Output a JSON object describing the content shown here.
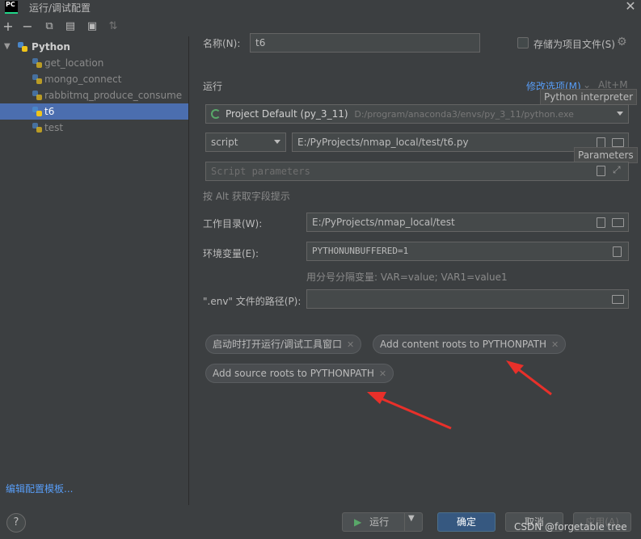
{
  "window": {
    "title": "运行/调试配置",
    "logo_text": "PC"
  },
  "toolbar": {
    "add": "+",
    "remove": "−",
    "copy": "⧉",
    "save": "▤",
    "folder": "▣",
    "sort": "⇅"
  },
  "tree": {
    "root": {
      "label": "Python"
    },
    "items": [
      {
        "label": "get_location"
      },
      {
        "label": "mongo_connect"
      },
      {
        "label": "rabbitmq_produce_consume"
      },
      {
        "label": "t6"
      },
      {
        "label": "test"
      }
    ]
  },
  "edit_templates": "编辑配置模板...",
  "form": {
    "name_label": "名称(N):",
    "name_value": "t6",
    "store_label": "存储为项目文件(S)",
    "run_section": "运行",
    "modify_options": "修改选项(M)",
    "modify_shortcut": "Alt+M",
    "interpreter_tooltip": "Python interpreter",
    "interpreter_name": "Project Default (py_3_11)",
    "interpreter_path": "D:/program/anaconda3/envs/py_3_11/python.exe",
    "script_type": "script",
    "script_path": "E:/PyProjects/nmap_local/test/t6.py",
    "parameters_tooltip": "Parameters",
    "script_params_placeholder": "Script parameters",
    "alt_hint": "按 Alt 获取字段提示",
    "workdir_label": "工作目录(W):",
    "workdir_value": "E:/PyProjects/nmap_local/test",
    "env_label": "环境变量(E):",
    "env_value": "PYTHONUNBUFFERED=1",
    "env_hint": "用分号分隔变量: VAR=value; VAR1=value1",
    "dotenv_label": "\".env\" 文件的路径(P):",
    "dotenv_value": ""
  },
  "chips": [
    {
      "label": "启动时打开运行/调试工具窗口"
    },
    {
      "label": "Add content roots to PYTHONPATH"
    },
    {
      "label": "Add source roots to PYTHONPATH"
    }
  ],
  "buttons": {
    "help": "?",
    "run": "运行",
    "ok": "确定",
    "cancel": "取消",
    "apply": "应用(A)"
  },
  "watermark": "CSDN @forgetable tree",
  "colors": {
    "accent": "#4b6eaf",
    "link": "#589df6",
    "annotation_arrow": "#e8302a",
    "run_icon": "#59a869"
  }
}
